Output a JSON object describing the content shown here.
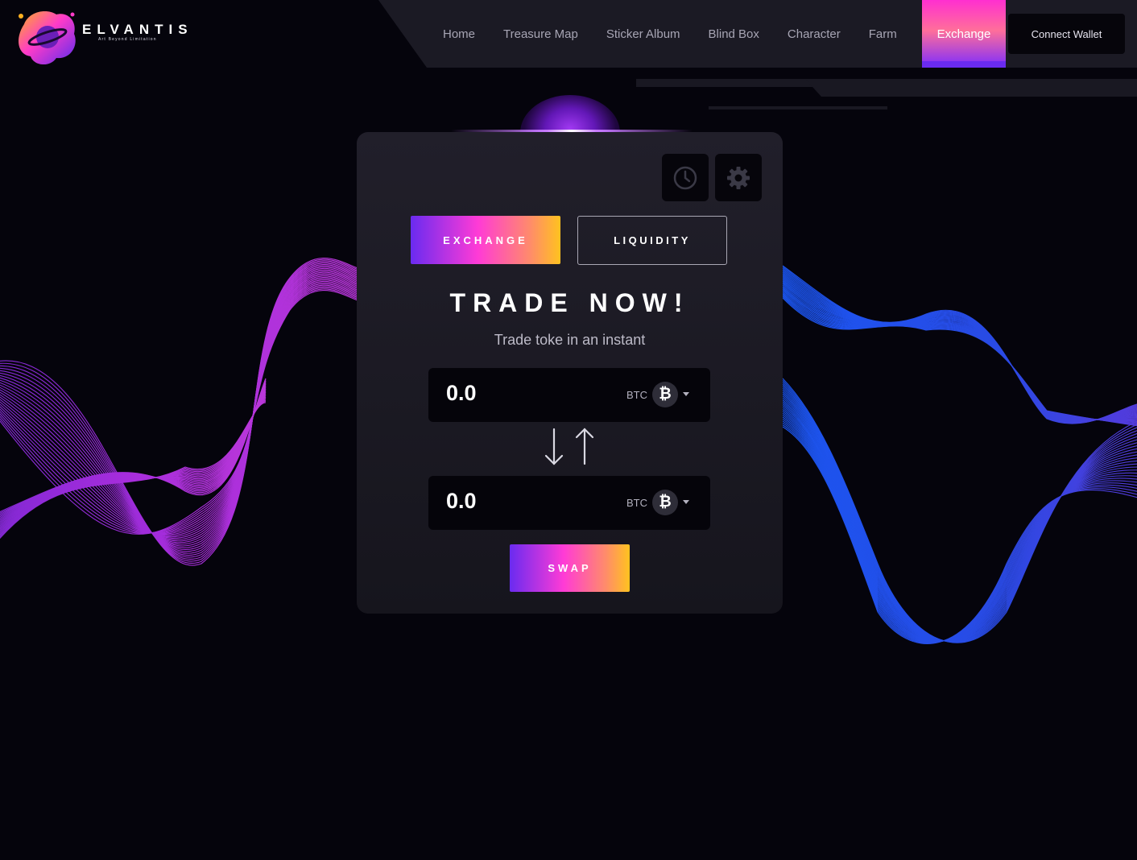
{
  "brand": {
    "name": "ELVANTIS",
    "tagline": "Art Beyond Limitation"
  },
  "nav": {
    "items": [
      "Home",
      "Treasure Map",
      "Sticker Album",
      "Blind Box",
      "Character",
      "Farm"
    ],
    "active": "Exchange",
    "connect_label": "Connect Wallet"
  },
  "card": {
    "icons": [
      "clock-icon",
      "gear-icon"
    ],
    "tab_exchange": "EXCHANGE",
    "tab_liquidity": "LIQUIDITY",
    "title": "TRADE NOW!",
    "subtitle": "Trade toke in an instant",
    "from": {
      "value": "0.0",
      "currency": "BTC",
      "coin_symbol": "₿"
    },
    "to": {
      "value": "0.0",
      "currency": "BTC",
      "coin_symbol": "₿"
    },
    "swap_label": "SWAP"
  },
  "colors": {
    "background": "#05040c",
    "accent_gradient": [
      "#6a2bf0",
      "#ff3bd6",
      "#ff8c6a",
      "#ffc21f"
    ],
    "wave_left": "#a82ee8",
    "wave_right": "#2848e8"
  }
}
